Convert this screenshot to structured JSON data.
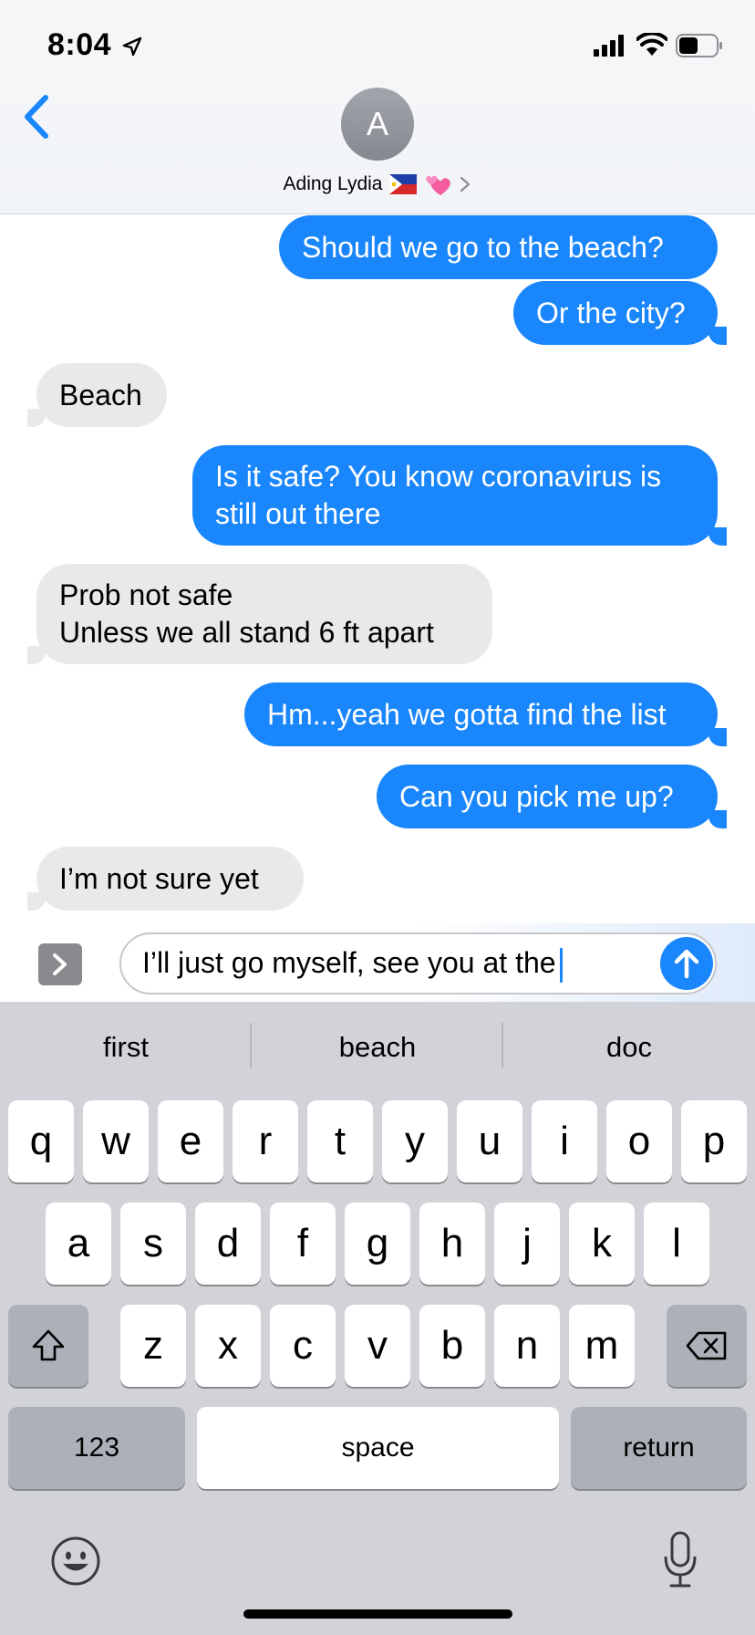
{
  "status_bar": {
    "time": "8:04"
  },
  "header": {
    "avatar_initial": "A",
    "contact_name": "Ading Lydia"
  },
  "colors": {
    "accent": "#1a86fb",
    "incoming_bubble": "#e9e9eb",
    "keyboard_bg": "#d1d3d9"
  },
  "messages": [
    {
      "dir": "out",
      "lines": [
        "Should we go to the beach?"
      ]
    },
    {
      "dir": "out",
      "lines": [
        "Or the city?"
      ]
    },
    {
      "dir": "in",
      "lines": [
        "Beach"
      ]
    },
    {
      "dir": "out",
      "lines": [
        "Is it safe? You know coronavirus is",
        "still out there"
      ]
    },
    {
      "dir": "in",
      "lines": [
        "Prob not safe",
        "Unless we all stand 6 ft apart"
      ]
    },
    {
      "dir": "out",
      "lines": [
        "Hm...yeah we gotta find the list"
      ]
    },
    {
      "dir": "out",
      "lines": [
        "Can you pick me up?"
      ]
    },
    {
      "dir": "in",
      "lines": [
        "I’m not sure yet"
      ]
    }
  ],
  "composer": {
    "text": "I’ll just go myself, see you at the"
  },
  "suggestions": [
    "first",
    "beach",
    "doc"
  ],
  "keyboard": {
    "row1": [
      "q",
      "w",
      "e",
      "r",
      "t",
      "y",
      "u",
      "i",
      "o",
      "p"
    ],
    "row2": [
      "a",
      "s",
      "d",
      "f",
      "g",
      "h",
      "j",
      "k",
      "l"
    ],
    "row3": [
      "z",
      "x",
      "c",
      "v",
      "b",
      "n",
      "m"
    ],
    "numbers_key": "123",
    "space_key": "space",
    "return_key": "return"
  }
}
